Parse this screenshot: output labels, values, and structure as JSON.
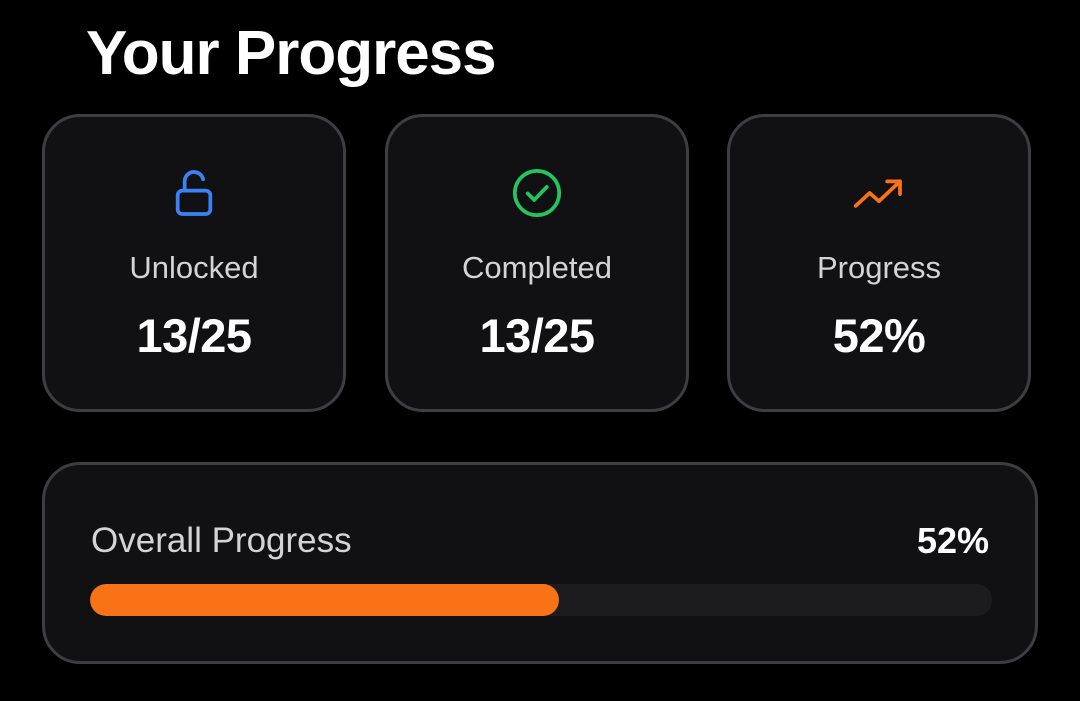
{
  "page": {
    "title": "Your Progress"
  },
  "stats": [
    {
      "icon": "unlock-icon",
      "label": "Unlocked",
      "value": "13/25",
      "color": "#3b82f6"
    },
    {
      "icon": "check-circle-icon",
      "label": "Completed",
      "value": "13/25",
      "color": "#22c55e"
    },
    {
      "icon": "trending-up-icon",
      "label": "Progress",
      "value": "52%",
      "color": "#f97316"
    }
  ],
  "overall": {
    "label": "Overall Progress",
    "value_text": "52%",
    "progress_percent": 52,
    "bar_color": "#f97316"
  }
}
